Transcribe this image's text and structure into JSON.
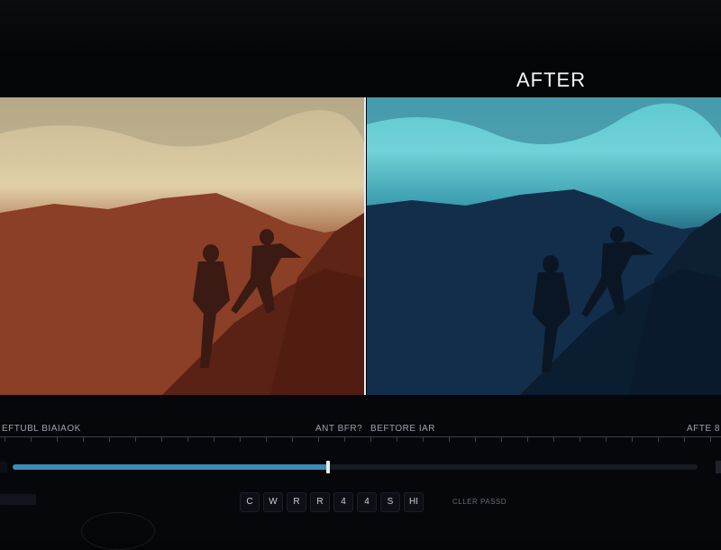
{
  "header": {
    "left_label": "",
    "right_label": "AFTER"
  },
  "panes": {
    "before": {
      "label_left": "EFTUBL BIAIAOK",
      "label_right": "ANT BFR?"
    },
    "after": {
      "label_left": "BEFTORE IAR",
      "label_right": "AFTE 8"
    }
  },
  "timeline": {
    "progress": 0.46
  },
  "controls": {
    "buttons": [
      "C",
      "W",
      "R",
      "R",
      "4",
      "4",
      "S",
      "HI"
    ],
    "status": "CLLER PASSD"
  },
  "colors": {
    "accent": "#3c8bb5",
    "divider": "#e9eef2"
  }
}
